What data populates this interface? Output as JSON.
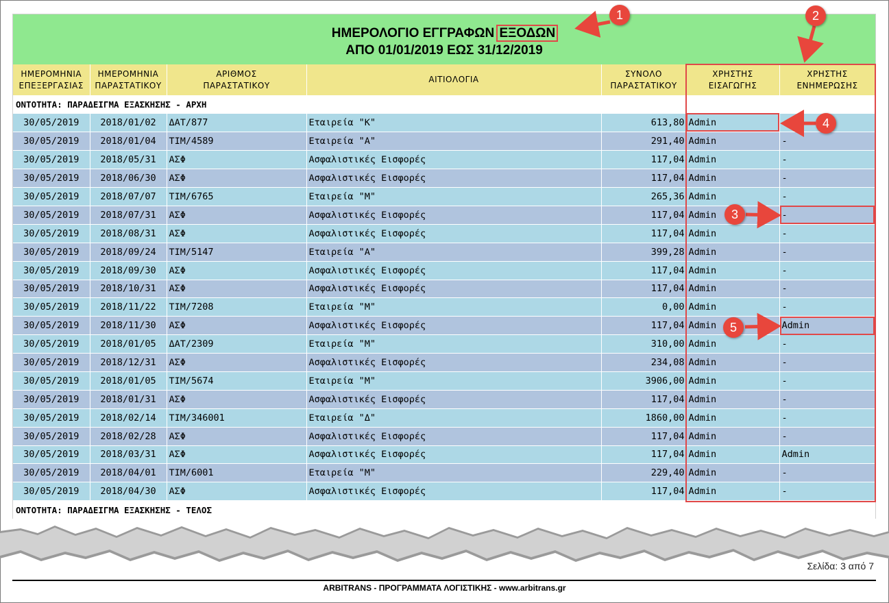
{
  "report": {
    "title_prefix": "ΗΜΕΡΟΛΟΓΙΟ ΕΓΓΡΑΦΩΝ",
    "title_highlight": "ΕΞΟΔΩΝ",
    "period": "ΑΠΟ 01/01/2019 ΕΩΣ 31/12/2019"
  },
  "columns": [
    {
      "line1": "ΗΜΕΡΟΜΗΝΙΑ",
      "line2": "ΕΠΕΞΕΡΓΑΣΙΑΣ"
    },
    {
      "line1": "ΗΜΕΡΟΜΗΝΙΑ",
      "line2": "ΠΑΡΑΣΤΑΤΙΚΟΥ"
    },
    {
      "line1": "ΑΡΙΘΜΟΣ",
      "line2": "ΠΑΡΑΣΤΑΤΙΚΟΥ"
    },
    {
      "line1": "ΑΙΤΙΟΛΟΓΙΑ",
      "line2": ""
    },
    {
      "line1": "ΣΥΝΟΛΟ",
      "line2": "ΠΑΡΑΣΤΑΤΙΚΟΥ"
    },
    {
      "line1": "ΧΡΗΣΤΗΣ",
      "line2": "ΕΙΣΑΓΩΓΗΣ"
    },
    {
      "line1": "ΧΡΗΣΤΗΣ",
      "line2": "ΕΝΗΜΕΡΩΣΗΣ"
    }
  ],
  "section_start": "ΟΝΤΟΤΗΤΑ: ΠΑΡΑΔΕΙΓΜΑ ΕΞΑΣΚΗΣΗΣ  -  ΑΡΧΗ",
  "section_end": "ΟΝΤΟΤΗΤΑ: ΠΑΡΑΔΕΙΓΜΑ ΕΞΑΣΚΗΣΗΣ  -  ΤΕΛΟΣ",
  "rows": [
    [
      "30/05/2019",
      "2018/01/02",
      "ΔΑΤ/877",
      "Εταιρεία \"Κ\"",
      "613,80",
      "Admin",
      ""
    ],
    [
      "30/05/2019",
      "2018/01/04",
      "ΤΙΜ/4589",
      "Εταιρεία \"Α\"",
      "291,40",
      "Admin",
      "-"
    ],
    [
      "30/05/2019",
      "2018/05/31",
      "ΑΣΦ",
      "Ασφαλιστικές Εισφορές",
      "117,04",
      "Admin",
      "-"
    ],
    [
      "30/05/2019",
      "2018/06/30",
      "ΑΣΦ",
      "Ασφαλιστικές Εισφορές",
      "117,04",
      "Admin",
      "-"
    ],
    [
      "30/05/2019",
      "2018/07/07",
      "ΤΙΜ/6765",
      "Εταιρεία \"Μ\"",
      "265,36",
      "Admin",
      "-"
    ],
    [
      "30/05/2019",
      "2018/07/31",
      "ΑΣΦ",
      "Ασφαλιστικές Εισφορές",
      "117,04",
      "Admin",
      "-"
    ],
    [
      "30/05/2019",
      "2018/08/31",
      "ΑΣΦ",
      "Ασφαλιστικές Εισφορές",
      "117,04",
      "Admin",
      "-"
    ],
    [
      "30/05/2019",
      "2018/09/24",
      "ΤΙΜ/5147",
      "Εταιρεία \"Α\"",
      "399,28",
      "Admin",
      "-"
    ],
    [
      "30/05/2019",
      "2018/09/30",
      "ΑΣΦ",
      "Ασφαλιστικές Εισφορές",
      "117,04",
      "Admin",
      "-"
    ],
    [
      "30/05/2019",
      "2018/10/31",
      "ΑΣΦ",
      "Ασφαλιστικές Εισφορές",
      "117,04",
      "Admin",
      "-"
    ],
    [
      "30/05/2019",
      "2018/11/22",
      "ΤΙΜ/7208",
      "Εταιρεία \"Μ\"",
      "0,00",
      "Admin",
      "-"
    ],
    [
      "30/05/2019",
      "2018/11/30",
      "ΑΣΦ",
      "Ασφαλιστικές Εισφορές",
      "117,04",
      "Admin",
      "Admin"
    ],
    [
      "30/05/2019",
      "2018/01/05",
      "ΔΑΤ/2309",
      "Εταιρεία \"Μ\"",
      "310,00",
      "Admin",
      "-"
    ],
    [
      "30/05/2019",
      "2018/12/31",
      "ΑΣΦ",
      "Ασφαλιστικές Εισφορές",
      "234,08",
      "Admin",
      "-"
    ],
    [
      "30/05/2019",
      "2018/01/05",
      "ΤΙΜ/5674",
      "Εταιρεία \"Μ\"",
      "3906,00",
      "Admin",
      "-"
    ],
    [
      "30/05/2019",
      "2018/01/31",
      "ΑΣΦ",
      "Ασφαλιστικές Εισφορές",
      "117,04",
      "Admin",
      "-"
    ],
    [
      "30/05/2019",
      "2018/02/14",
      "ΤΙΜ/346001",
      "Εταιρεία \"Δ\"",
      "1860,00",
      "Admin",
      "-"
    ],
    [
      "30/05/2019",
      "2018/02/28",
      "ΑΣΦ",
      "Ασφαλιστικές Εισφορές",
      "117,04",
      "Admin",
      "-"
    ],
    [
      "30/05/2019",
      "2018/03/31",
      "ΑΣΦ",
      "Ασφαλιστικές Εισφορές",
      "117,04",
      "Admin",
      "Admin"
    ],
    [
      "30/05/2019",
      "2018/04/01",
      "ΤΙΜ/6001",
      "Εταιρεία \"Μ\"",
      "229,40",
      "Admin",
      "-"
    ],
    [
      "30/05/2019",
      "2018/04/30",
      "ΑΣΦ",
      "Ασφαλιστικές Εισφορές",
      "117,04",
      "Admin",
      "-"
    ]
  ],
  "callouts": [
    "1",
    "2",
    "3",
    "4",
    "5"
  ],
  "page_number": "Σελίδα: 3 από 7",
  "footer": "ARBITRANS - ΠΡΟΓΡΑΜΜΑΤΑ ΛΟΓΙΣΤΙΚΗΣ -  www.arbitrans.gr",
  "colors": {
    "title_band": "#8fe88f",
    "header": "#f0e68c",
    "row_light": "#add8e6",
    "row_dark": "#b0c4de",
    "annotation": "#e04848"
  }
}
